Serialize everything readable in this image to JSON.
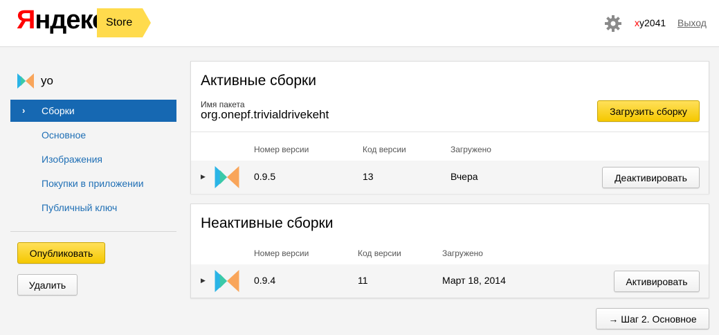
{
  "header": {
    "logo_first": "Я",
    "logo_rest": "ндекс",
    "store_label": "Store",
    "settings_icon": "gear-icon",
    "user_first": "x",
    "user_rest": "y2041",
    "logout_label": "Выход"
  },
  "sidebar": {
    "app_name": "yo",
    "app_icon": "app-bowtie-icon",
    "items": [
      {
        "label": "Сборки",
        "active": true
      },
      {
        "label": "Основное"
      },
      {
        "label": "Изображения"
      },
      {
        "label": "Покупки в приложении"
      },
      {
        "label": "Публичный ключ"
      }
    ],
    "publish_label": "Опубликовать",
    "delete_label": "Удалить"
  },
  "active": {
    "title": "Активные сборки",
    "package_label": "Имя пакета",
    "package_name": "org.onepf.trivialdrivekeht",
    "upload_label": "Загрузить сборку",
    "columns": [
      "Номер версии",
      "Код версии",
      "Загружено"
    ],
    "rows": [
      {
        "version": "0.9.5",
        "code": "13",
        "uploaded": "Вчера",
        "action": "Деактивировать"
      }
    ]
  },
  "inactive": {
    "title": "Неактивные сборки",
    "columns": [
      "Номер версии",
      "Код версии",
      "Загружено"
    ],
    "rows": [
      {
        "version": "0.9.4",
        "code": "11",
        "uploaded": "Март 18, 2014",
        "action": "Активировать"
      }
    ]
  },
  "next_step_label": "→ Шаг 2. Основное",
  "colors": {
    "accent_yellow": "#ffdb4d",
    "nav_active": "#1668b2",
    "link_blue": "#1f6fb5"
  }
}
